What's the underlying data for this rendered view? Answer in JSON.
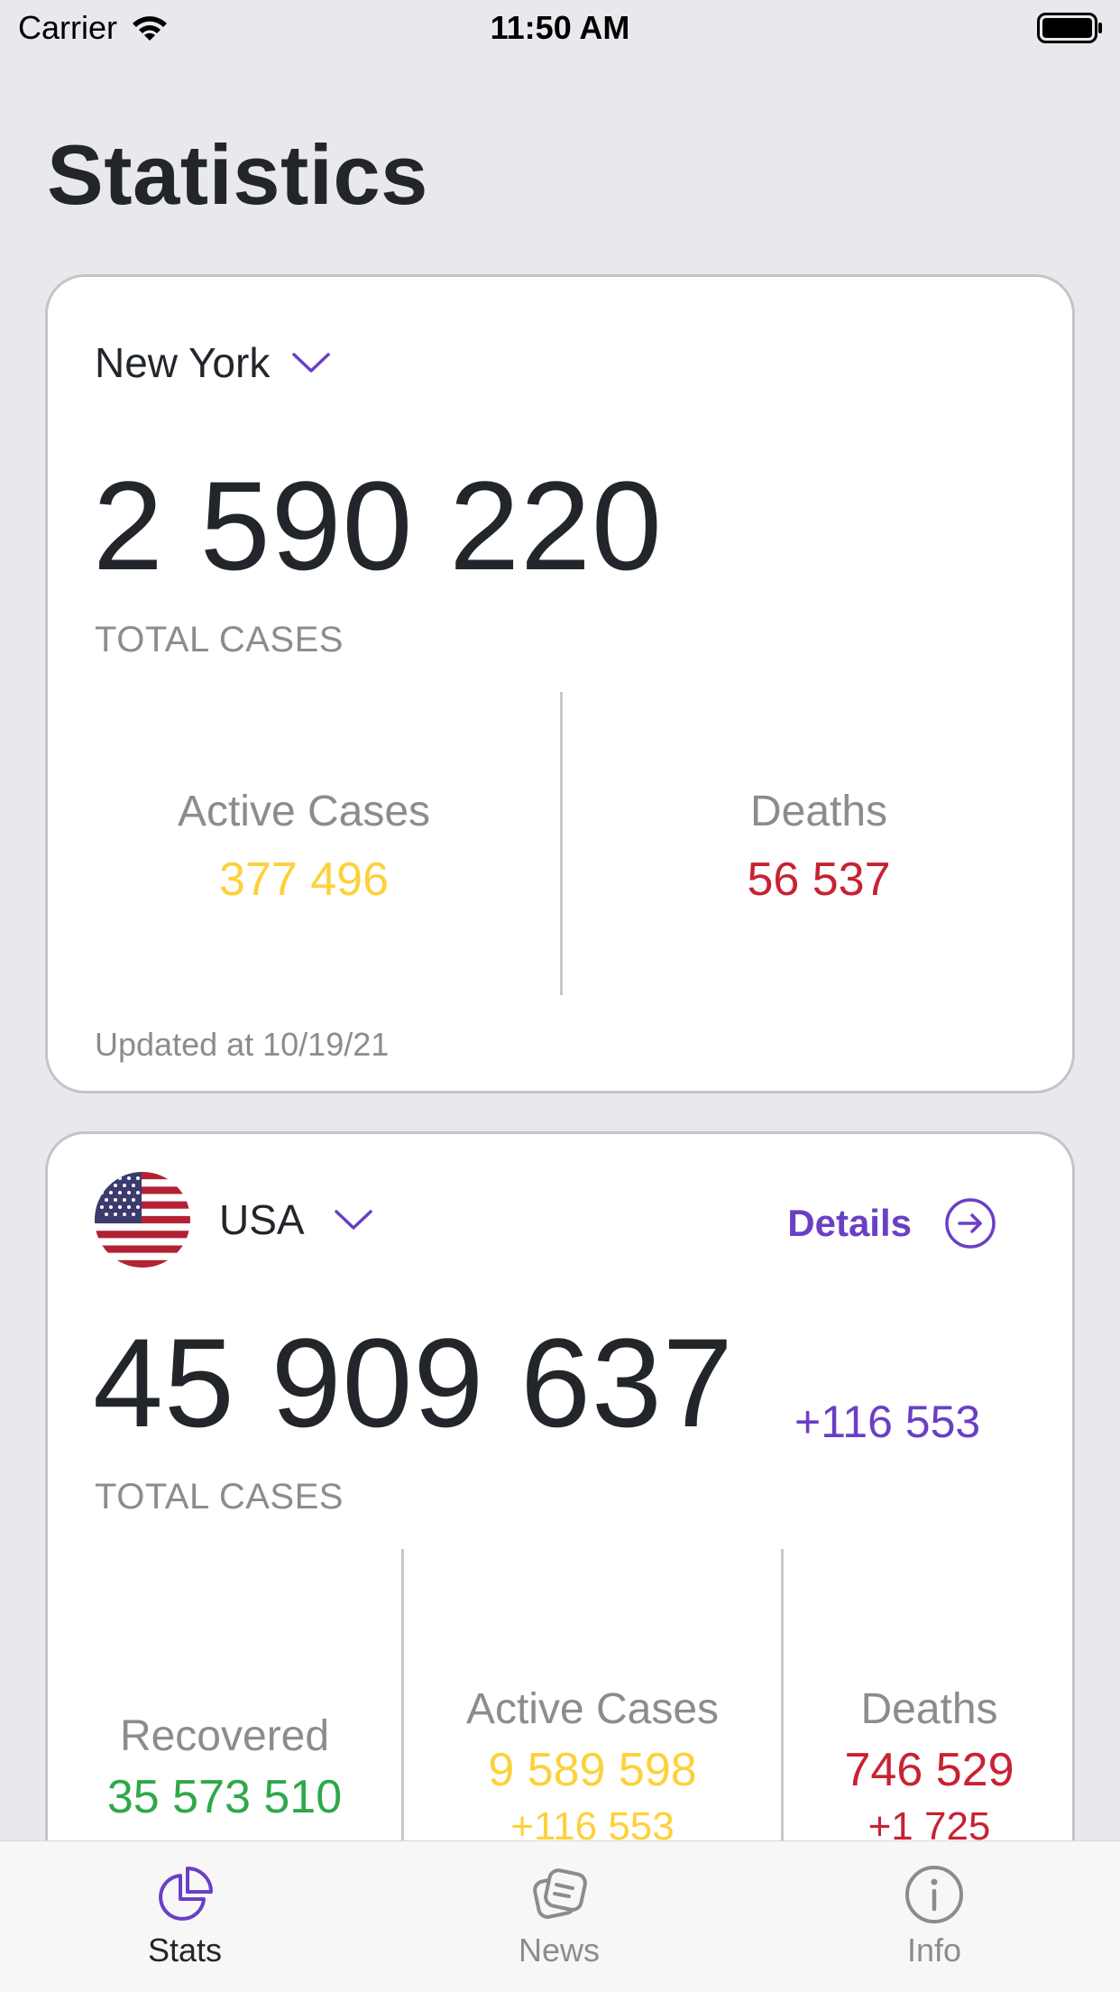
{
  "status_bar": {
    "carrier": "Carrier",
    "time": "11:50 AM"
  },
  "page": {
    "title": "Statistics"
  },
  "local_card": {
    "region": "New York",
    "total_cases": "2 590 220",
    "total_cases_label": "TOTAL CASES",
    "active_label": "Active Cases",
    "active_value": "377 496",
    "deaths_label": "Deaths",
    "deaths_value": "56 537",
    "updated": "Updated at 10/19/21"
  },
  "country_card": {
    "country": "USA",
    "flag_icon": "usa-flag-icon",
    "details_label": "Details",
    "total_cases": "45 909 637",
    "total_delta": "+116 553",
    "total_cases_label": "TOTAL CASES",
    "recovered_label": "Recovered",
    "recovered_value": "35 573 510",
    "active_label": "Active Cases",
    "active_value": "9 589 598",
    "active_delta": "+116 553",
    "deaths_label": "Deaths",
    "deaths_value": "746 529",
    "deaths_delta": "+1 725"
  },
  "tab_bar": {
    "tabs": [
      {
        "label": "Stats",
        "icon": "pie-chart-icon",
        "active": true
      },
      {
        "label": "News",
        "icon": "news-icon",
        "active": false
      },
      {
        "label": "Info",
        "icon": "info-icon",
        "active": false
      }
    ]
  },
  "colors": {
    "accent": "#6a3fc5",
    "active_cases": "#fdd13b",
    "deaths": "#c82232",
    "recovered": "#2ea84a"
  }
}
